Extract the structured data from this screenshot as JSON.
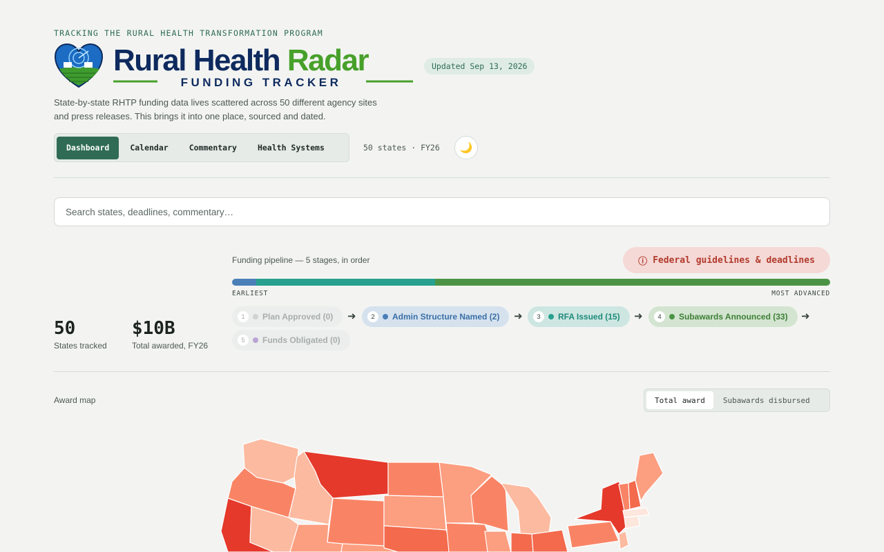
{
  "header": {
    "eyebrow": "TRACKING THE RURAL HEALTH TRANSFORMATION PROGRAM",
    "logo_text": "Rural Health Radar",
    "logo_subtitle": "FUNDING TRACKER",
    "updated": "Updated Sep 13, 2026",
    "description": "State-by-state RHTP funding data lives scattered across 50 different agency sites and press releases. This brings it into one place, sourced and dated."
  },
  "nav": {
    "tabs": [
      "Dashboard",
      "Calendar",
      "Commentary",
      "Health Systems"
    ],
    "active": "Dashboard",
    "meta": "50 states · FY26",
    "theme_icon": "moon-icon"
  },
  "search": {
    "placeholder": "Search states, deadlines, commentary…",
    "value": ""
  },
  "stats": [
    {
      "value": "50",
      "label": "States tracked"
    },
    {
      "value": "$10B",
      "label": "Total awarded, FY26"
    }
  ],
  "pipeline": {
    "title": "Funding pipeline — 5 stages, in order",
    "guidelines_label": "Federal guidelines & deadlines",
    "guidelines_icon": "info-circle-icon",
    "earliest_label": "EARLIEST",
    "advanced_label": "MOST ADVANCED",
    "bar_fractions": [
      0.04,
      0.3,
      0.66
    ],
    "bar_colors": [
      "#4a7fb8",
      "#27a08f",
      "#4b9445"
    ],
    "stages": [
      {
        "num": "1",
        "label": "Plan Approved (0)",
        "count": 0,
        "color": "#cfd3d1"
      },
      {
        "num": "2",
        "label": "Admin Structure Named (2)",
        "count": 2,
        "color": "#4a7fb8"
      },
      {
        "num": "3",
        "label": "RFA Issued (15)",
        "count": 15,
        "color": "#27a08f"
      },
      {
        "num": "4",
        "label": "Subawards Announced (33)",
        "count": 33,
        "color": "#4b9445"
      },
      {
        "num": "5",
        "label": "Funds Obligated (0)",
        "count": 0,
        "color": "#b9a4d4"
      }
    ]
  },
  "map": {
    "title": "Award map",
    "toggle": [
      "Total award",
      "Subawards disbursed"
    ],
    "active": "Total award",
    "scale_colors": [
      "#fde6dc",
      "#fcbaa0",
      "#fc9e80",
      "#f98465",
      "#f36a4d",
      "#e5392b"
    ]
  }
}
